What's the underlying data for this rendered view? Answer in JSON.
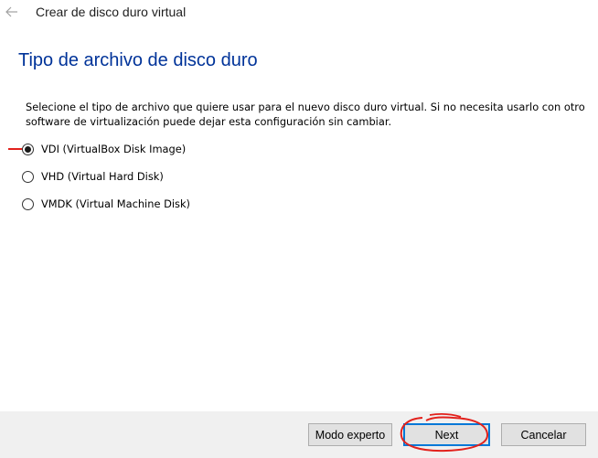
{
  "window": {
    "title": "Crear de disco duro virtual"
  },
  "page": {
    "heading": "Tipo de archivo de disco duro",
    "description": "Selecione el tipo de archivo que quiere usar para el nuevo disco duro virtual. Si no necesita usarlo con otro software de virtualización puede dejar esta configuración sin cambiar."
  },
  "options": [
    {
      "label": "VDI (VirtualBox Disk Image)",
      "selected": true
    },
    {
      "label": "VHD (Virtual Hard Disk)",
      "selected": false
    },
    {
      "label": "VMDK (Virtual Machine Disk)",
      "selected": false
    }
  ],
  "buttons": {
    "expert": "Modo experto",
    "next": "Next",
    "cancel": "Cancelar"
  },
  "colors": {
    "heading": "#003399",
    "annotation": "#e2211c",
    "focus_border": "#0078d7",
    "footer_bg": "#f0f0f0"
  },
  "icons": {
    "back": "arrow-left-icon"
  }
}
